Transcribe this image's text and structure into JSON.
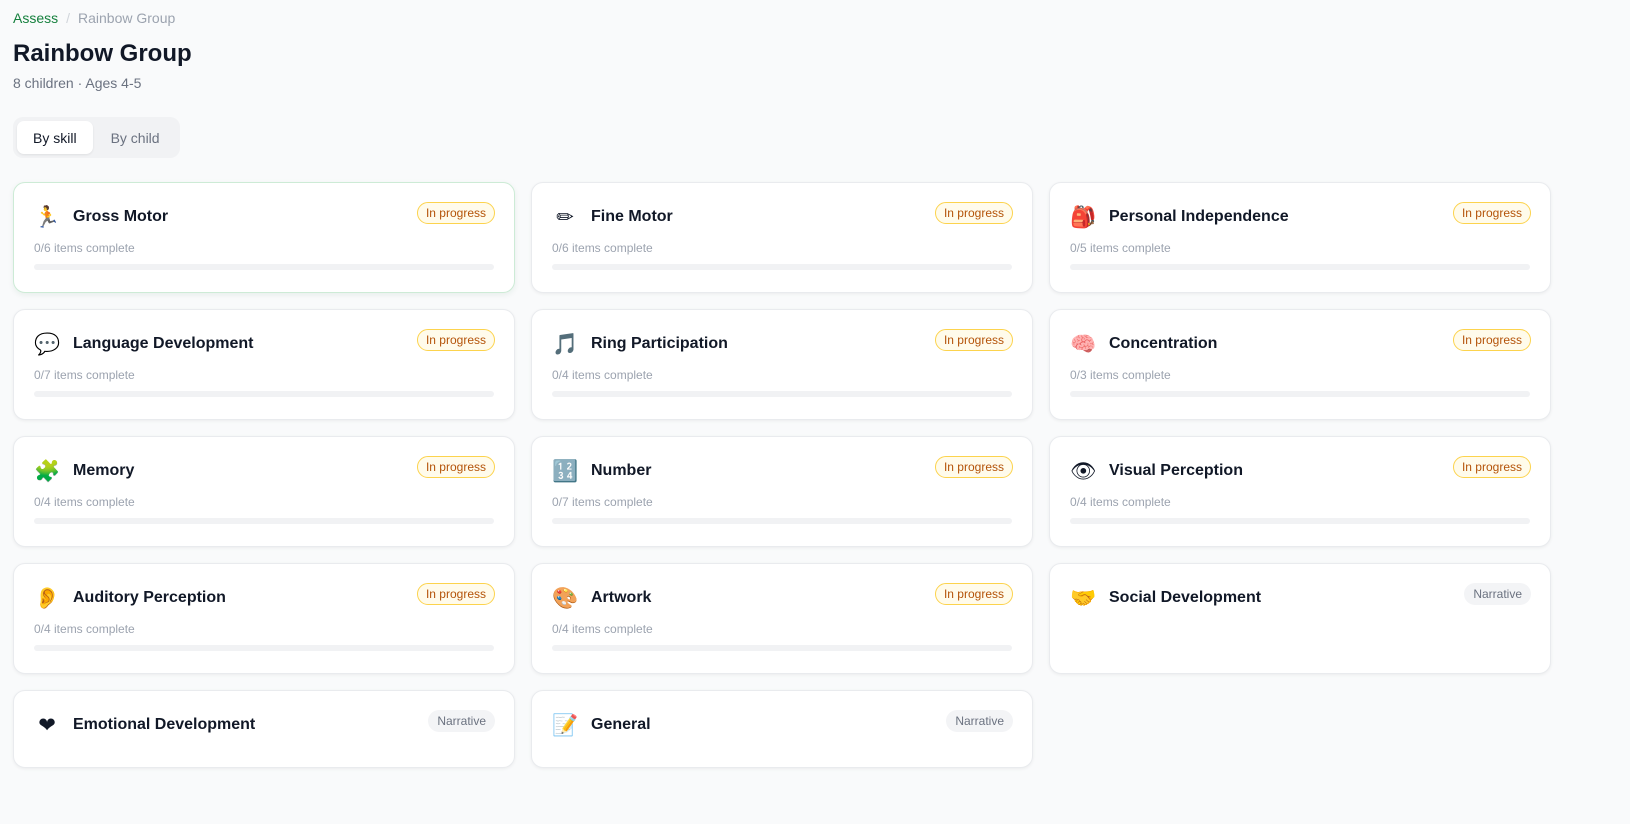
{
  "breadcrumb": {
    "root": "Assess",
    "separator": "/",
    "current": "Rainbow Group"
  },
  "title": "Rainbow Group",
  "subtitle": "8 children · Ages 4-5",
  "view_toggle": {
    "by_skill": "By skill",
    "by_child": "By child",
    "selected": "By skill"
  },
  "colors": {
    "accent": "#15803d",
    "in_progress_text": "#b45309",
    "in_progress_border": "#fcd34d",
    "narrative_bg": "#f3f4f6"
  },
  "skills": [
    {
      "icon": "🏃",
      "icon_name": "running-person-icon",
      "name": "Gross Motor",
      "status": "In progress",
      "items": "0/6 items complete",
      "progress": 0
    },
    {
      "icon": "✏",
      "icon_name": "pencil-icon",
      "name": "Fine Motor",
      "status": "In progress",
      "items": "0/6 items complete",
      "progress": 0
    },
    {
      "icon": "🎒",
      "icon_name": "backpack-icon",
      "name": "Personal Independence",
      "status": "In progress",
      "items": "0/5 items complete",
      "progress": 0
    },
    {
      "icon": "💬",
      "icon_name": "speech-bubble-icon",
      "name": "Language Development",
      "status": "In progress",
      "items": "0/7 items complete",
      "progress": 0
    },
    {
      "icon": "🎵",
      "icon_name": "music-note-icon",
      "name": "Ring Participation",
      "status": "In progress",
      "items": "0/4 items complete",
      "progress": 0
    },
    {
      "icon": "🧠",
      "icon_name": "brain-icon",
      "name": "Concentration",
      "status": "In progress",
      "items": "0/3 items complete",
      "progress": 0
    },
    {
      "icon": "🧩",
      "icon_name": "puzzle-piece-icon",
      "name": "Memory",
      "status": "In progress",
      "items": "0/4 items complete",
      "progress": 0
    },
    {
      "icon": "🔢",
      "icon_name": "numbers-icon",
      "name": "Number",
      "status": "In progress",
      "items": "0/7 items complete",
      "progress": 0
    },
    {
      "icon": "👁",
      "icon_name": "eye-icon",
      "name": "Visual Perception",
      "status": "In progress",
      "items": "0/4 items complete",
      "progress": 0
    },
    {
      "icon": "👂",
      "icon_name": "ear-icon",
      "name": "Auditory Perception",
      "status": "In progress",
      "items": "0/4 items complete",
      "progress": 0
    },
    {
      "icon": "🎨",
      "icon_name": "palette-icon",
      "name": "Artwork",
      "status": "In progress",
      "items": "0/4 items complete",
      "progress": 0
    },
    {
      "icon": "🤝",
      "icon_name": "handshake-icon",
      "name": "Social Development",
      "status": "Narrative"
    },
    {
      "icon": "❤",
      "icon_name": "heart-icon",
      "name": "Emotional Development",
      "status": "Narrative"
    },
    {
      "icon": "📝",
      "icon_name": "memo-icon",
      "name": "General",
      "status": "Narrative"
    }
  ]
}
